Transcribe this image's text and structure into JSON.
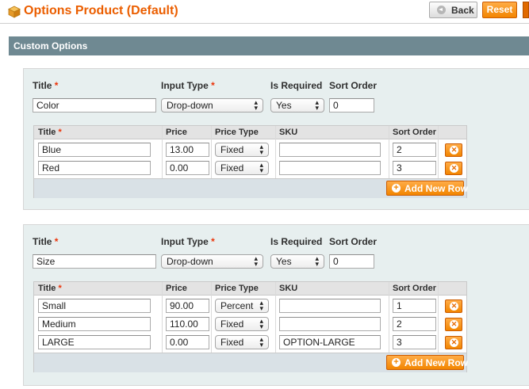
{
  "header": {
    "title": "Options Product (Default)",
    "back_label": "Back",
    "reset_label": "Reset",
    "icon": "package-icon"
  },
  "section": {
    "title": "Custom Options"
  },
  "labels": {
    "title": "Title",
    "input_type": "Input Type",
    "is_required": "Is Required",
    "sort_order": "Sort Order",
    "required_mark": "*",
    "grid_title": "Title",
    "grid_price": "Price",
    "grid_price_type": "Price Type",
    "grid_sku": "SKU",
    "grid_sort_order": "Sort Order",
    "add_new_row": "Add New Row"
  },
  "options": [
    {
      "title": "Color",
      "input_type": "Drop-down",
      "is_required": "Yes",
      "sort_order": "0",
      "rows": [
        {
          "title": "Blue",
          "price": "13.00",
          "price_type": "Fixed",
          "sku": "",
          "sort_order": "2"
        },
        {
          "title": "Red",
          "price": "0.00",
          "price_type": "Fixed",
          "sku": "",
          "sort_order": "3"
        }
      ]
    },
    {
      "title": "Size",
      "input_type": "Drop-down",
      "is_required": "Yes",
      "sort_order": "0",
      "rows": [
        {
          "title": "Small",
          "price": "90.00",
          "price_type": "Percent",
          "sku": "",
          "sort_order": "1"
        },
        {
          "title": "Medium",
          "price": "110.00",
          "price_type": "Fixed",
          "sku": "",
          "sort_order": "2"
        },
        {
          "title": "LARGE",
          "price": "0.00",
          "price_type": "Fixed",
          "sku": "OPTION-LARGE",
          "sort_order": "3"
        }
      ]
    }
  ],
  "colors": {
    "accent": "#eb5e00",
    "button_orange": "#f28500",
    "section_header": "#6f8992",
    "option_box": "#e7efef",
    "required": "#eb340a"
  }
}
